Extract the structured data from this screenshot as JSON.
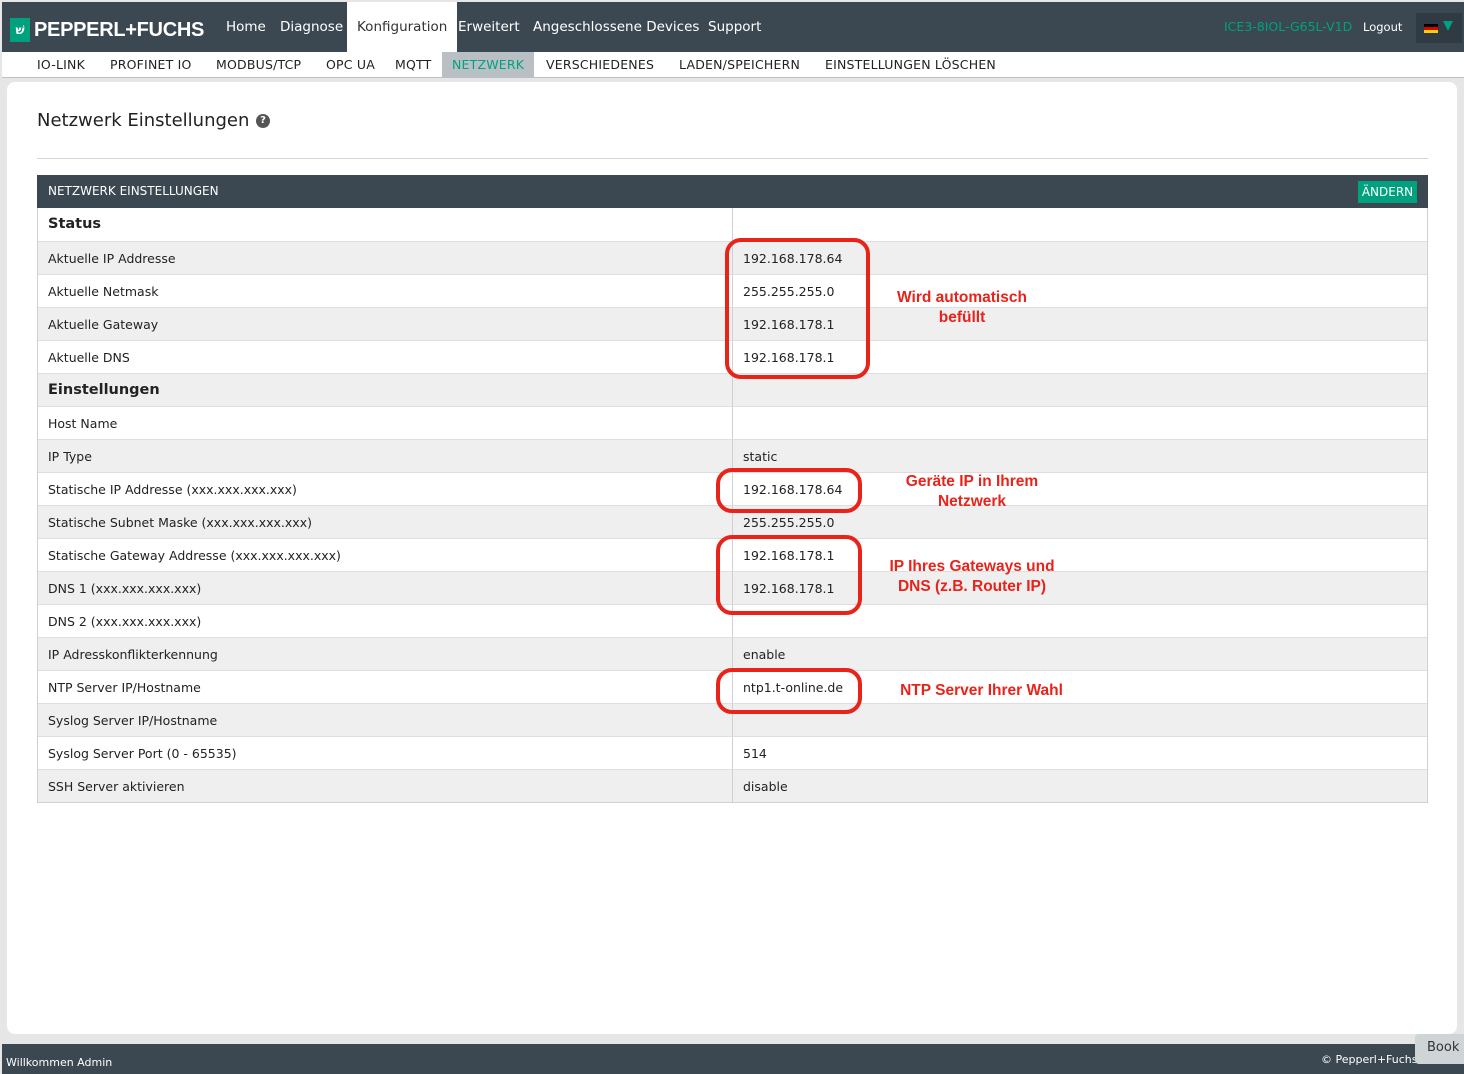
{
  "brand": {
    "logo_mark": "P+F",
    "logo_text": "PEPPERL+FUCHS"
  },
  "topnav": {
    "items": [
      {
        "label": "Home"
      },
      {
        "label": "Diagnose"
      },
      {
        "label": "Konfiguration",
        "active": true
      },
      {
        "label": "Erweitert"
      },
      {
        "label": "Angeschlossene Devices"
      },
      {
        "label": "Support"
      }
    ],
    "device_id": "ICE3-8IOL-G65L-V1D",
    "logout": "Logout",
    "language_flag": "de-flag-icon"
  },
  "subnav": {
    "items": [
      {
        "label": "IO-LINK"
      },
      {
        "label": "PROFINET IO"
      },
      {
        "label": "MODBUS/TCP"
      },
      {
        "label": "OPC UA"
      },
      {
        "label": "MQTT"
      },
      {
        "label": "NETZWERK",
        "active": true
      },
      {
        "label": "VERSCHIEDENES"
      },
      {
        "label": "LADEN/SPEICHERN"
      },
      {
        "label": "EINSTELLUNGEN LÖSCHEN"
      }
    ]
  },
  "page": {
    "title": "Netzwerk Einstellungen",
    "help_icon": "?"
  },
  "table": {
    "header": "NETZWERK EINSTELLUNGEN",
    "edit_button": "ÄNDERN",
    "rows": [
      {
        "label": "Status",
        "value": "",
        "section": true
      },
      {
        "label": "Aktuelle IP Addresse",
        "value": "192.168.178.64"
      },
      {
        "label": "Aktuelle Netmask",
        "value": "255.255.255.0"
      },
      {
        "label": "Aktuelle Gateway",
        "value": "192.168.178.1"
      },
      {
        "label": "Aktuelle DNS",
        "value": "192.168.178.1"
      },
      {
        "label": "Einstellungen",
        "value": "",
        "section": true
      },
      {
        "label": "Host Name",
        "value": ""
      },
      {
        "label": "IP Type",
        "value": "static"
      },
      {
        "label": "Statische IP Addresse (xxx.xxx.xxx.xxx)",
        "value": "192.168.178.64"
      },
      {
        "label": "Statische Subnet Maske (xxx.xxx.xxx.xxx)",
        "value": "255.255.255.0"
      },
      {
        "label": "Statische Gateway Addresse (xxx.xxx.xxx.xxx)",
        "value": "192.168.178.1"
      },
      {
        "label": "DNS 1 (xxx.xxx.xxx.xxx)",
        "value": "192.168.178.1"
      },
      {
        "label": "DNS 2 (xxx.xxx.xxx.xxx)",
        "value": ""
      },
      {
        "label": "IP Adresskonflikterkennung",
        "value": "enable"
      },
      {
        "label": "NTP Server IP/Hostname",
        "value": "ntp1.t-online.de"
      },
      {
        "label": "Syslog Server IP/Hostname",
        "value": ""
      },
      {
        "label": "Syslog Server Port (0 - 65535)",
        "value": "514"
      },
      {
        "label": "SSH Server aktivieren",
        "value": "disable"
      }
    ]
  },
  "annotations": {
    "auto": "Wird automatisch befüllt",
    "device_ip": "Geräte IP in Ihrem Netzwerk",
    "gateway_dns": "IP Ihres Gateways und DNS (z.B. Router IP)",
    "ntp": "NTP Server Ihrer Wahl",
    "color": "#e8231a"
  },
  "footer": {
    "welcome": "Willkommen Admin",
    "copyright": "© Pepperl+Fuchs",
    "book_tab": "Book"
  },
  "colors": {
    "navbar": "#3b4852",
    "accent": "#00a17e",
    "panel": "#ffffff",
    "background": "#e6e6e6"
  }
}
